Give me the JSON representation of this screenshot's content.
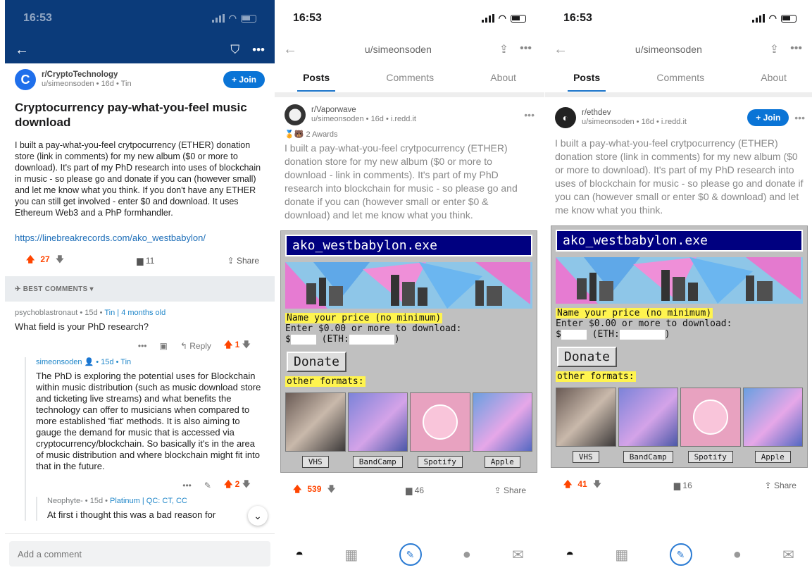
{
  "status": {
    "time": "16:53"
  },
  "p1": {
    "subreddit": "r/CryptoTechnology",
    "author_meta": "u/simeonsoden • 16d • Tin",
    "join": "+ Join",
    "title": "Cryptocurrency pay-what-you-feel music download",
    "body": "I built a pay-what-you-feel crytpocurrency (ETHER) donation store (link in comments) for my new album ($0 or more to download). It's part of my PhD research into uses of blockchain in music - so please go and donate if you can (however small) and let me know what you think. If you don't have any ETHER you can still get involved - enter $0 and download. It uses Ethereum Web3 and a PhP formhandler.",
    "url": "https://linebreakrecords.com/ako_westbabylon/",
    "score": "27",
    "comments": "11",
    "share": "Share",
    "sort": "BEST COMMENTS",
    "c1_user": "psychoblastronaut • 15d • ",
    "c1_flair": "Tin | 4 months old",
    "c1_text": "What field is your PhD research?",
    "c1_reply": "Reply",
    "c1_score": "1",
    "c2_user": "simeonsoden",
    "c2_meta": " • 15d • Tin",
    "c2_text": "The PhD is exploring the potential uses for Blockchain within music distribution (such as music download store and ticketing live streams) and what benefits the technology can offer to musicians when compared to more established 'fiat' methods. It is also aiming to gauge the demand for music that is accessed via cryptocurrency/blockchain. So basically it's in the area of music distribution and where blockchain might fit into that in the future.",
    "c2_score": "2",
    "c3_user": "Neophyte- • 15d • ",
    "c3_flair": "Platinum | QC: CT, CC",
    "c3_text": "At first i thought this was a bad reason for",
    "add_comment": "Add a comment"
  },
  "profile": {
    "username": "u/simeonsoden",
    "tab_posts": "Posts",
    "tab_comments": "Comments",
    "tab_about": "About"
  },
  "store": {
    "title": "ako_westbabylon.exe",
    "name_price": "Name your price (no minimum)",
    "enter": "Enter $0.00 or more to download:",
    "dollar": "$",
    "eth_open": "(ETH:",
    "eth_close": ")",
    "donate": "Donate",
    "other": "other formats:",
    "formats": [
      "VHS",
      "BandCamp",
      "Spotify",
      "Apple"
    ]
  },
  "p2": {
    "subreddit": "r/Vaporwave",
    "meta": "u/simeonsoden • 16d • i.redd.it",
    "awards": "2 Awards",
    "body": "I built a pay-what-you-feel crytpocurrency (ETHER) donation store for my new album ($0 or more to download - link in comments). It's part of my PhD research into blockchain for music - so please go and donate if you can (however small or enter $0 & download) and let me know what you think.",
    "score": "539",
    "comments": "46",
    "share": "Share"
  },
  "p3": {
    "subreddit": "r/ethdev",
    "meta": "u/simeonsoden • 16d • i.redd.it",
    "join": "+ Join",
    "body": "I built a pay-what-you-feel crytpocurrency (ETHER) donation store (link in comments) for my new album ($0 or more to download). It's part of my PhD research into uses of blockchain for music - so please go and donate if you can (however small or enter $0 & download) and let me know what you think.",
    "score": "41",
    "comments": "16",
    "share": "Share"
  }
}
